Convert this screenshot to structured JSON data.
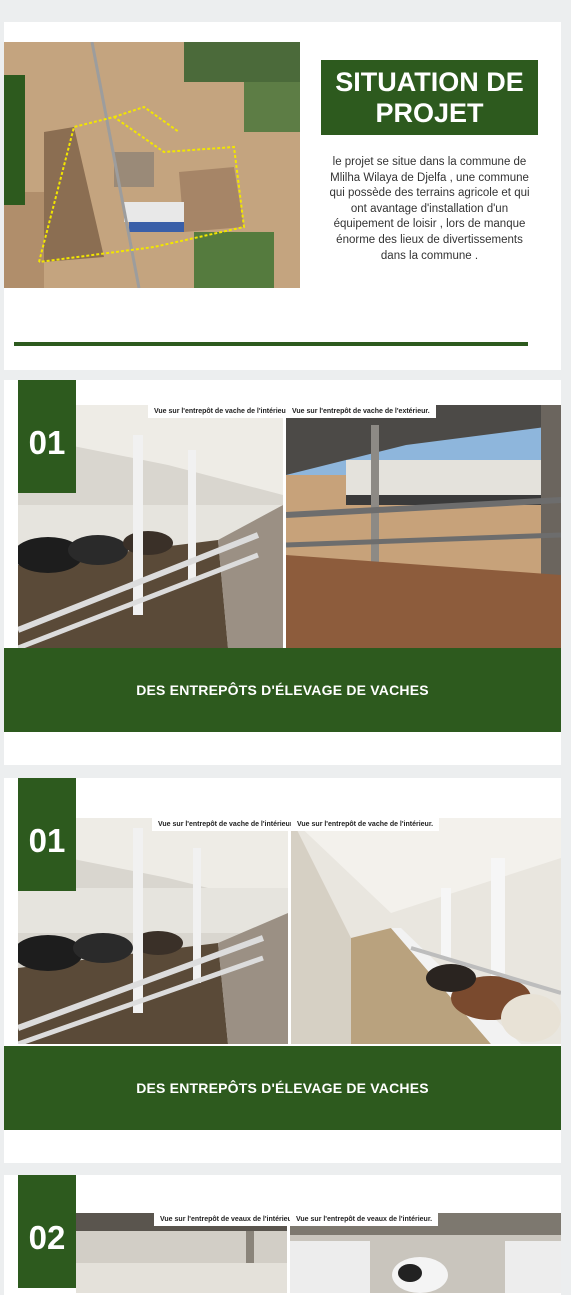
{
  "situation": {
    "title": "SITUATION DE PROJET",
    "description": "le projet se situe dans la commune de Mlilha Wilaya de Djelfa , une commune qui possède des terrains agricole et qui ont avantage d'installation d'un équipement de loisir , lors de manque énorme des lieux de divertissements dans la commune ."
  },
  "sections": [
    {
      "number": "01",
      "caption_left": "Vue sur l'entrepôt de vache de l'intérieur.",
      "caption_right": "Vue sur l'entrepôt de vache de l'extérieur.",
      "banner": "DES ENTREPÔTS D'ÉLEVAGE DE VACHES"
    },
    {
      "number": "01",
      "caption_left": "Vue sur l'entrepôt de vache de l'intérieur.",
      "caption_right": "Vue sur l'entrepôt de vache de l'intérieur.",
      "banner": "DES ENTREPÔTS D'ÉLEVAGE DE VACHES"
    },
    {
      "number": "02",
      "caption_left": "Vue sur l'entrepôt de veaux de l'intérieur.",
      "caption_right": "Vue sur l'entrepôt de veaux de l'intérieur."
    }
  ],
  "colors": {
    "brand_green": "#2d5a1e",
    "background": "#eceeef"
  }
}
